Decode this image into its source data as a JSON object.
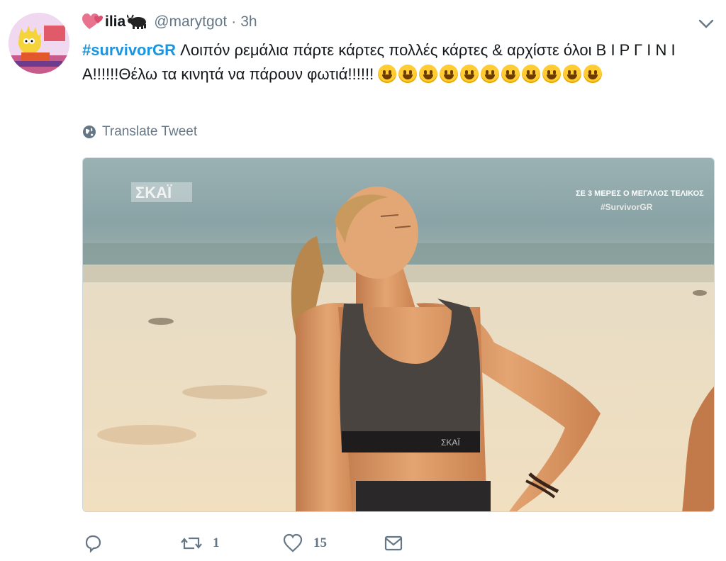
{
  "tweet": {
    "display_name": "ilia",
    "handle": "@marytgot",
    "separator": "·",
    "time": "3h",
    "hashtag": "#survivorGR",
    "text": " Λοιπόν ρεμάλια πάρτε κάρτες πολλές κάρτες & αρχίστε όλοι Β Ι Ρ Γ Ι Ν Ι Α!!!!!!Θέλω τα κινητά να πάρουν φωτιά!!!!!!",
    "translate_label": "Translate Tweet"
  },
  "media": {
    "channel_logo": "ΣΚΑΪ",
    "overlay_line1": "ΣΕ 3 ΜΕΡΕΣ Ο ΜΕΓΑΛΟΣ ΤΕΛΙΚΟΣ",
    "overlay_line2": "#SurvivorGR",
    "top_brand": "ΣΚΑΪ"
  },
  "actions": {
    "reply_count": "",
    "retweet_count": "1",
    "like_count": "15"
  },
  "icons": [
    "heart-emoji-icon",
    "bull-emoji-icon",
    "globe-icon",
    "chevron-down-icon",
    "reply-icon",
    "retweet-icon",
    "like-icon",
    "message-icon"
  ],
  "colors": {
    "hashtag": "#1b95e0",
    "secondary_text": "#657786",
    "emoji": "#ffcc33"
  }
}
